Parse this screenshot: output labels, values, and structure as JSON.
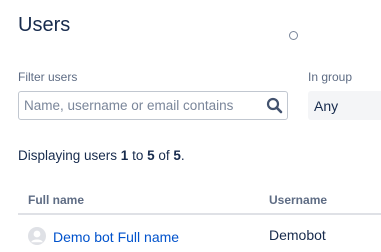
{
  "page": {
    "title": "Users"
  },
  "filter": {
    "label": "Filter users",
    "placeholder": "Name, username or email contains",
    "value": "",
    "search_icon": "search-icon"
  },
  "group_filter": {
    "label": "In group",
    "selected": "Any"
  },
  "summary": {
    "prefix": "Displaying users ",
    "from": "1",
    "to_word": " to ",
    "to": "5",
    "of_word": " of ",
    "total": "5",
    "suffix": "."
  },
  "table": {
    "columns": {
      "full_name": "Full name",
      "username": "Username"
    },
    "rows": [
      {
        "full_name": "Demo bot Full name",
        "username": "Demobot",
        "avatar_icon": "user-avatar-icon"
      }
    ]
  },
  "colors": {
    "link": "#0052cc",
    "text": "#172b4d",
    "muted": "#5e6c84",
    "border": "#c1c7d0"
  }
}
